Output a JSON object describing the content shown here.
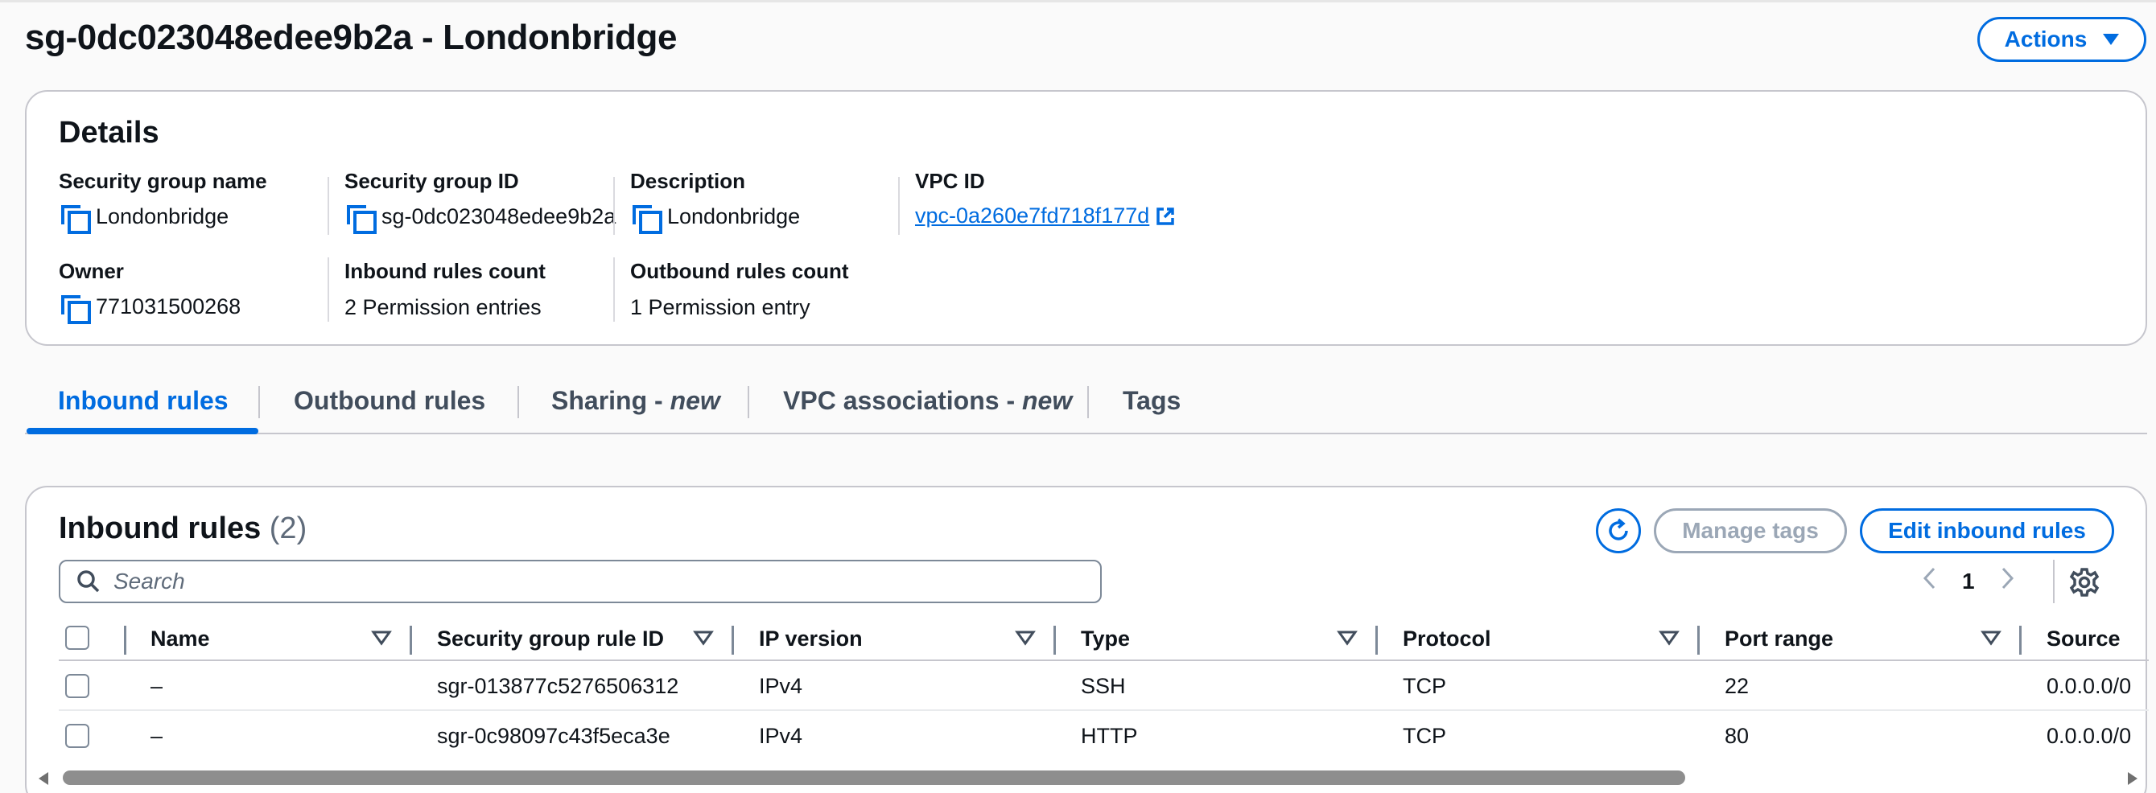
{
  "header": {
    "title": "sg-0dc023048edee9b2a - Londonbridge",
    "actions_label": "Actions"
  },
  "details": {
    "title": "Details",
    "fields": {
      "sg_name": {
        "label": "Security group name",
        "value": "Londonbridge"
      },
      "sg_id": {
        "label": "Security group ID",
        "value": "sg-0dc023048edee9b2a"
      },
      "description": {
        "label": "Description",
        "value": "Londonbridge"
      },
      "vpc_id": {
        "label": "VPC ID",
        "value": "vpc-0a260e7fd718f177d"
      },
      "owner": {
        "label": "Owner",
        "value": "771031500268"
      },
      "inbound_count": {
        "label": "Inbound rules count",
        "value": "2 Permission entries"
      },
      "outbound_count": {
        "label": "Outbound rules count",
        "value": "1 Permission entry"
      }
    }
  },
  "tabs": [
    {
      "label": "Inbound rules",
      "suffix": ""
    },
    {
      "label": "Outbound rules",
      "suffix": ""
    },
    {
      "label": "Sharing - ",
      "suffix": "new"
    },
    {
      "label": "VPC associations - ",
      "suffix": "new"
    },
    {
      "label": "Tags",
      "suffix": ""
    }
  ],
  "inbound": {
    "title": "Inbound rules",
    "count": "(2)",
    "manage_tags_label": "Manage tags",
    "edit_label": "Edit inbound rules",
    "search_placeholder": "Search",
    "page": "1",
    "columns": [
      "Name",
      "Security group rule ID",
      "IP version",
      "Type",
      "Protocol",
      "Port range",
      "Source"
    ],
    "rows": [
      {
        "name": "–",
        "rule_id": "sgr-013877c5276506312",
        "ip_version": "IPv4",
        "type": "SSH",
        "protocol": "TCP",
        "port_range": "22",
        "source": "0.0.0.0/0"
      },
      {
        "name": "–",
        "rule_id": "sgr-0c98097c43f5eca3e",
        "ip_version": "IPv4",
        "type": "HTTP",
        "protocol": "TCP",
        "port_range": "80",
        "source": "0.0.0.0/0"
      }
    ]
  },
  "colors": {
    "accent": "#006ce0",
    "disabled": "#9ba7b6",
    "text": "#0f141a",
    "border": "#c6c6cd"
  }
}
